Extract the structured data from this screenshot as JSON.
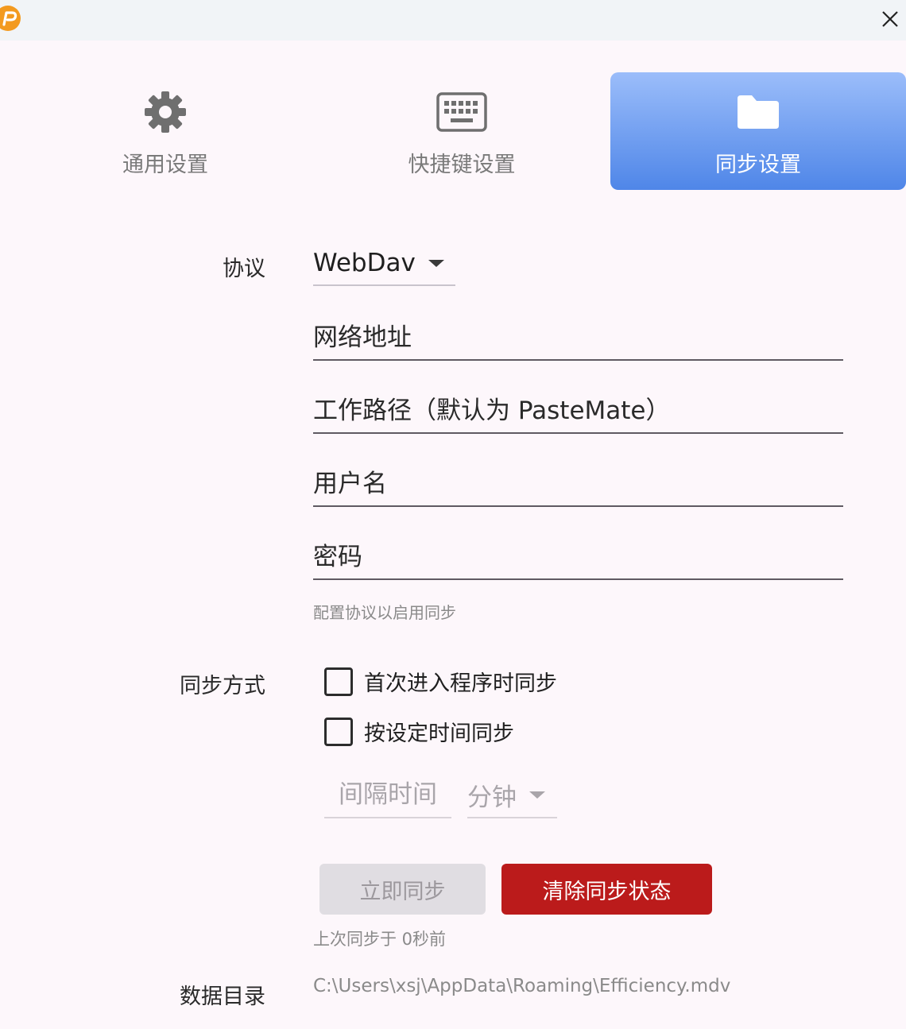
{
  "tabs": [
    {
      "label": "通用设置",
      "icon": "gear-icon"
    },
    {
      "label": "快捷键设置",
      "icon": "keyboard-icon"
    },
    {
      "label": "同步设置",
      "icon": "folder-icon",
      "active": true
    }
  ],
  "colors": {
    "active_tab_top": "#9bbdfa",
    "active_tab_bottom": "#4f86e8",
    "danger": "#bb1b1b",
    "logo": "#f39a1f"
  },
  "protocol": {
    "label": "协议",
    "value": "WebDav"
  },
  "fields": {
    "url_placeholder": "网络地址",
    "path_placeholder": "工作路径（默认为 PasteMate）",
    "username_placeholder": "用户名",
    "password_placeholder": "密码"
  },
  "hint": "配置协议以启用同步",
  "sync_mode": {
    "label": "同步方式",
    "option_startup": "首次进入程序时同步",
    "option_interval": "按设定时间同步",
    "interval_placeholder": "间隔时间",
    "unit": "分钟"
  },
  "buttons": {
    "sync_now": "立即同步",
    "clear_state": "清除同步状态"
  },
  "last_sync": "上次同步于 0秒前",
  "data_dir": {
    "label": "数据目录",
    "path": "C:\\Users\\xsj\\AppData\\Roaming\\Efficiency.mdv"
  }
}
